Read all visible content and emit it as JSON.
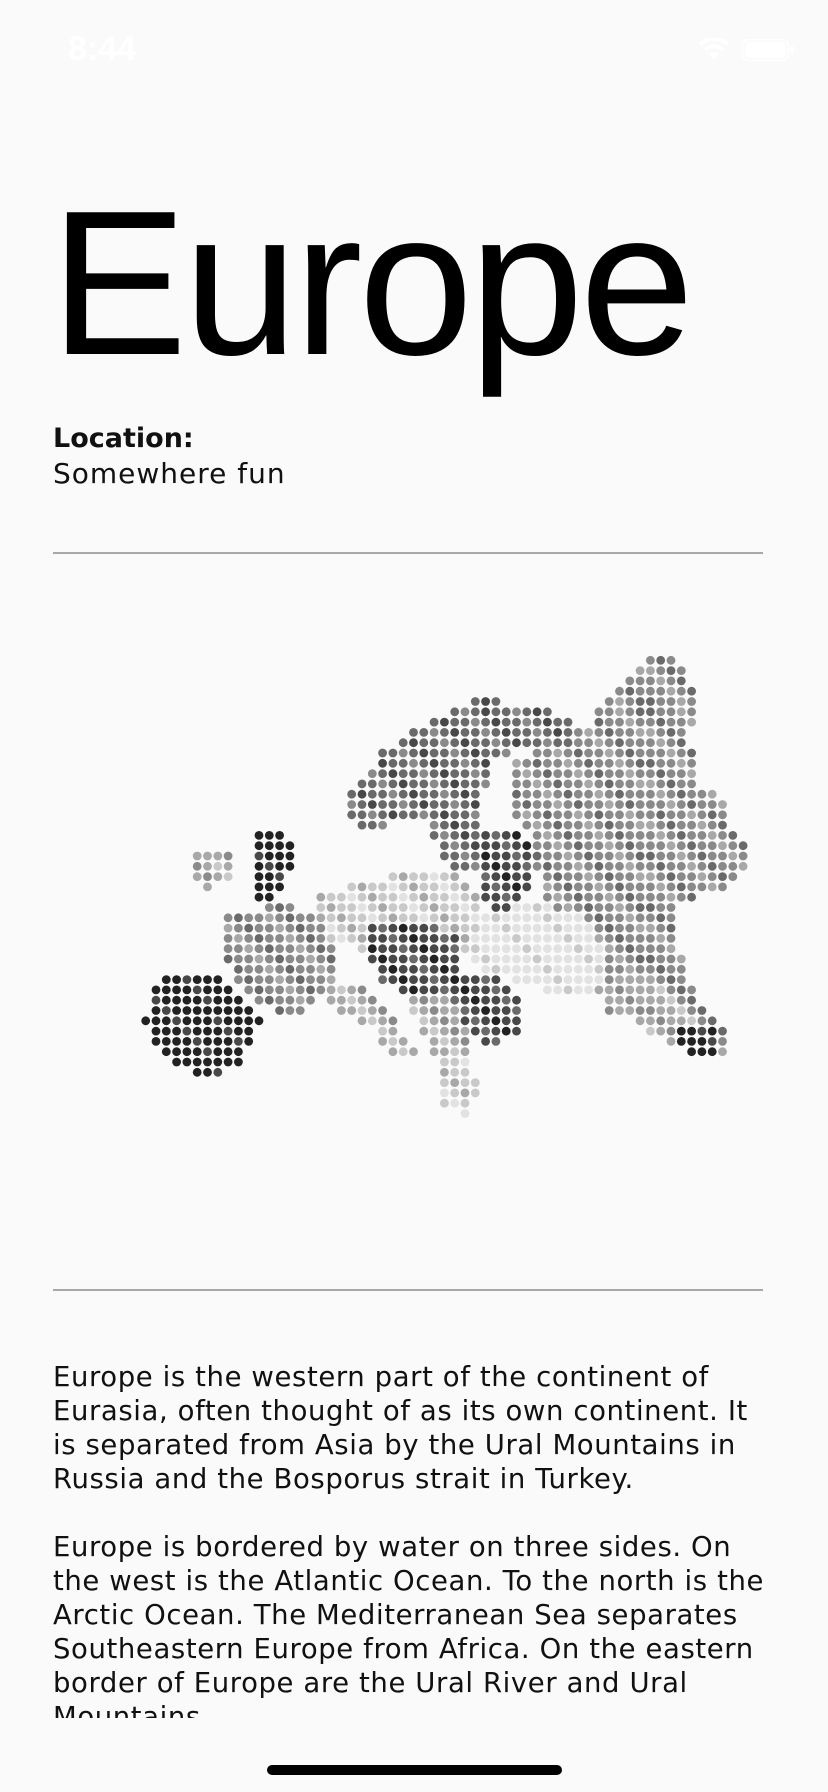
{
  "status_bar": {
    "time": "8:44",
    "icons": [
      "wifi-icon",
      "battery-icon"
    ],
    "text_color": "#ffffff"
  },
  "page": {
    "title": "Europe",
    "location_label": "Location:",
    "location_value": "Somewhere fun"
  },
  "map": {
    "icon": "europe-dot-map-icon",
    "dot_colors": [
      "#e2e2e2",
      "#c9c9c9",
      "#a8a8a8",
      "#8a8a8a",
      "#6a6a6a",
      "#484848",
      "#222222"
    ]
  },
  "description": {
    "paragraphs": [
      "Europe is the western part of the continent of Eurasia, often thought of as its own continent. It is separated from Asia by the Ural Mountains in Russia and the Bosporus strait in Turkey.",
      "Europe is bordered by water on three sides. On the west is the Atlantic Ocean. To the north is the Arctic Ocean. The Mediterranean Sea separates Southeastern Europe from Africa. On the eastern border of Europe are the Ural River and Ural Mountains."
    ]
  }
}
